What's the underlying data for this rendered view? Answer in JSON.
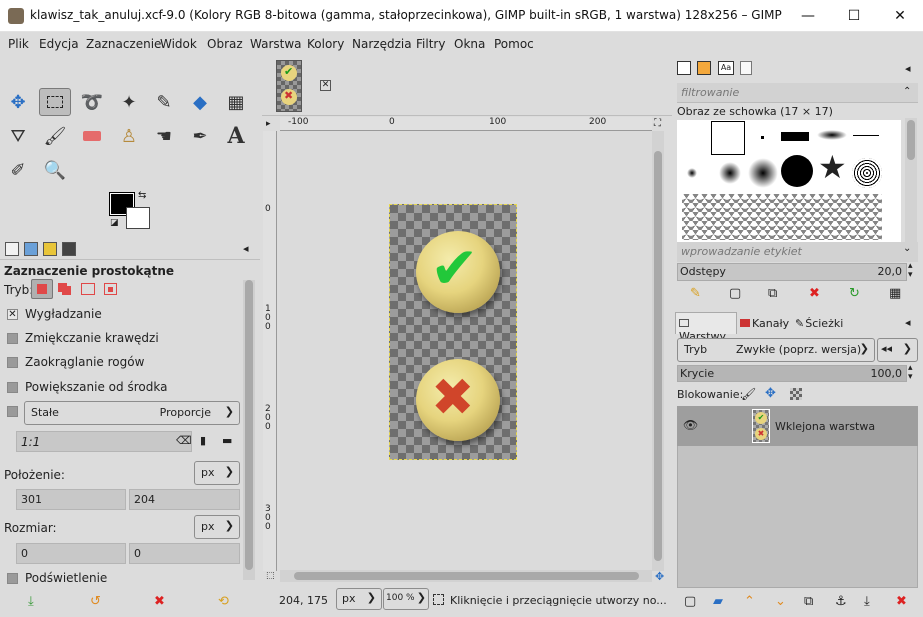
{
  "window": {
    "title": "klawisz_tak_anuluj.xcf-9.0 (Kolory RGB 8-bitowa (gamma, stałoprzecinkowa), GIMP built-in sRGB, 1 warstwa) 128x256 – GIMP",
    "minimize": "—",
    "maximize": "☐",
    "close": "✕"
  },
  "menu": [
    "Plik",
    "Edycja",
    "Zaznaczenie",
    "Widok",
    "Obraz",
    "Warstwa",
    "Kolory",
    "Narzędzia",
    "Filtry",
    "Okna",
    "Pomoc"
  ],
  "tool_options": {
    "title": "Zaznaczenie prostokątne",
    "mode_label": "Tryb:",
    "antialias": "Wygładzanie",
    "feather": "Zmiękczanie krawędzi",
    "rounded": "Zaokrąglanie rogów",
    "expand": "Powiększanie od środka",
    "fixed_label": "Stałe",
    "fixed_value": "Proporcje",
    "ratio": "1:1",
    "position_label": "Położenie:",
    "position_unit": "px",
    "pos_x": "301",
    "pos_y": "204",
    "size_label": "Rozmiar:",
    "size_unit": "px",
    "size_w": "0",
    "size_h": "0",
    "highlight": "Podświetlenie"
  },
  "rulers": {
    "h": [
      "-100",
      "0",
      "100",
      "200"
    ],
    "v": [
      "0",
      "1\n0\n0",
      "2\n0\n0",
      "3\n0\n0"
    ]
  },
  "status": {
    "coords": "204, 175",
    "unit": "px",
    "zoom": "100 %",
    "message": "Kliknięcie i przeciągnięcie utworzy no..."
  },
  "brushes": {
    "filter_placeholder": "filtrowanie",
    "title": "Obraz ze schowka (17 × 17)",
    "tag_placeholder": "wprowadzanie etykiet",
    "spacing_label": "Odstępy",
    "spacing_value": "20,0"
  },
  "layers": {
    "tabs": [
      "Warstwy",
      "Kanały",
      "Ścieżki"
    ],
    "mode_label": "Tryb",
    "mode_value": "Zwykłe (poprz. wersja)",
    "opacity_label": "Krycie",
    "opacity_value": "100,0",
    "lock_label": "Blokowanie:",
    "layer_name": "Wklejona warstwa"
  }
}
